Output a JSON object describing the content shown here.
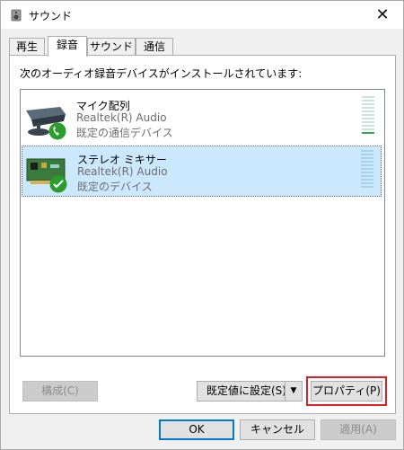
{
  "window": {
    "title": "サウンド",
    "close_glyph": "✕"
  },
  "tabs": [
    {
      "label": "再生",
      "active": false
    },
    {
      "label": "録音",
      "active": true
    },
    {
      "label": "サウンド",
      "active": false
    },
    {
      "label": "通信",
      "active": false
    }
  ],
  "recording": {
    "instruction": "次のオーディオ録音デバイスがインストールされています:",
    "devices": [
      {
        "name": "マイク配列",
        "driver": "Realtek(R) Audio",
        "status": "既定の通信デバイス",
        "icon": "microphone-array-icon",
        "badge": "phone-badge-icon",
        "selected": false
      },
      {
        "name": "ステレオ ミキサー",
        "driver": "Realtek(R) Audio",
        "status": "既定のデバイス",
        "icon": "sound-card-icon",
        "badge": "checkmark-badge-icon",
        "selected": true
      }
    ]
  },
  "buttons": {
    "configure": "構成(C)",
    "set_default": "既定値に設定(S)",
    "set_default_arrow": "▼",
    "properties": "プロパティ(P)",
    "ok": "OK",
    "cancel": "キャンセル",
    "apply": "適用(A)"
  },
  "colors": {
    "selection": "#cce8ff",
    "accent": "#0078d7",
    "highlight": "#e21f26",
    "badge_green": "#2a9d2a"
  }
}
